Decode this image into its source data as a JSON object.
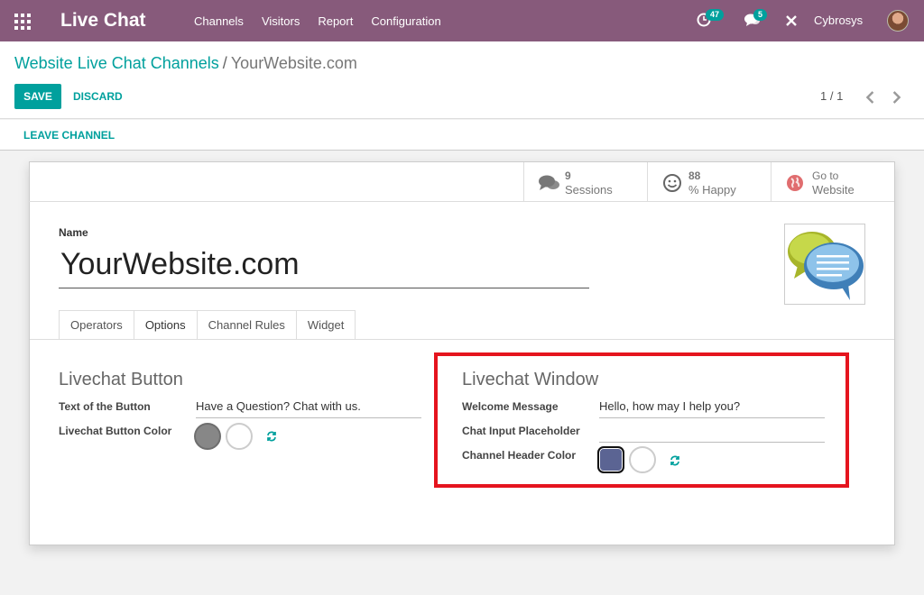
{
  "navbar": {
    "brand": "Live Chat",
    "menu": [
      "Channels",
      "Visitors",
      "Report",
      "Configuration"
    ],
    "activity_count": "47",
    "messages_count": "5",
    "user": "Cybrosys",
    "color": "#875a7b"
  },
  "breadcrumb": {
    "parent": "Website Live Chat Channels",
    "separator": "/",
    "current": "YourWebsite.com"
  },
  "actions": {
    "save": "SAVE",
    "discard": "DISCARD"
  },
  "pager": {
    "value": "1 / 1"
  },
  "status": {
    "leave": "LEAVE CHANNEL"
  },
  "stat_buttons": [
    {
      "value": "9",
      "label": "Sessions",
      "icon": "comments-icon"
    },
    {
      "value": "88",
      "label": "% Happy",
      "icon": "smile-icon"
    },
    {
      "value": "Go to",
      "label": "Website",
      "icon": "globe-icon"
    }
  ],
  "form": {
    "name_label": "Name",
    "name_value": "YourWebsite.com",
    "tabs": [
      "Operators",
      "Options",
      "Channel Rules",
      "Widget"
    ],
    "active_tab": "Options",
    "button_section": {
      "title": "Livechat Button",
      "text_label": "Text of the Button",
      "text_value": "Have a Question? Chat with us.",
      "color_label": "Livechat Button Color",
      "color": "#878787"
    },
    "window_section": {
      "title": "Livechat Window",
      "welcome_label": "Welcome Message",
      "welcome_value": "Hello, how may I help you?",
      "placeholder_label": "Chat Input Placeholder",
      "placeholder_value": "",
      "header_color_label": "Channel Header Color",
      "header_color": "#5b6493"
    }
  }
}
